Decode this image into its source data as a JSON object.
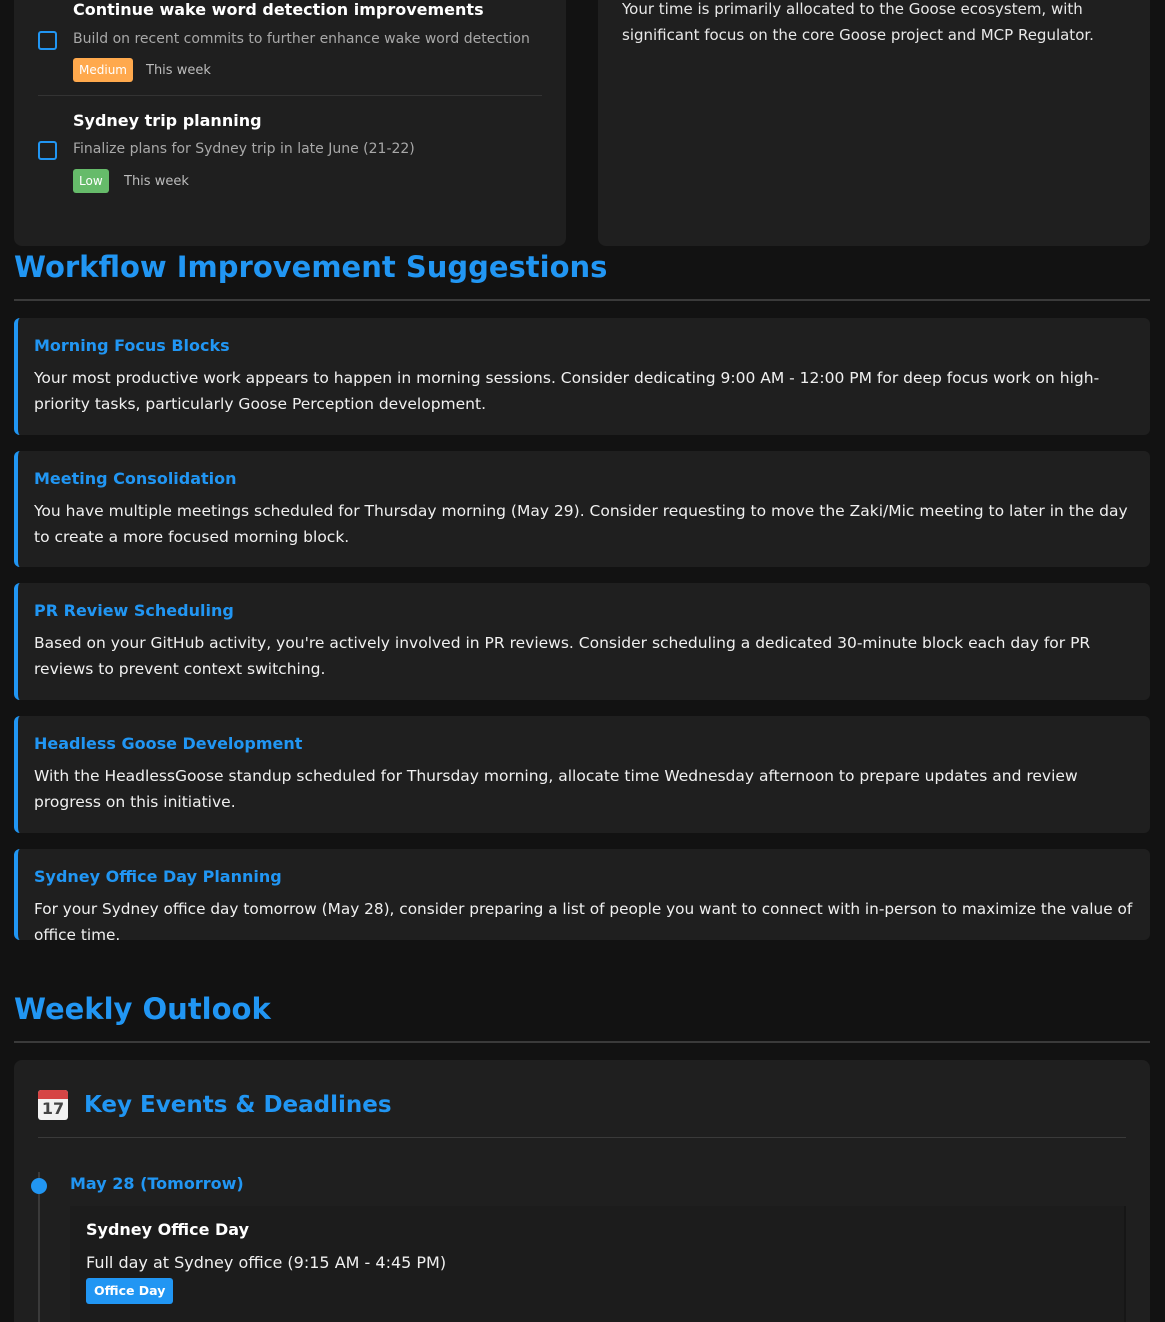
{
  "tasks": [
    {
      "title": "Continue wake word detection improvements",
      "description": "Build on recent commits to further enhance wake word detection",
      "priority": "Medium",
      "when": "This week"
    },
    {
      "title": "Sydney trip planning",
      "description": "Finalize plans for Sydney trip in late June (21-22)",
      "priority": "Low",
      "when": "This week"
    }
  ],
  "allocation": {
    "text": "Your time is primarily allocated to the Goose ecosystem, with significant focus on the core Goose project and MCP Regulator."
  },
  "workflow": {
    "title": "Workflow Improvement Suggestions",
    "suggestions": [
      {
        "title": "Morning Focus Blocks",
        "body": "Your most productive work appears to happen in morning sessions. Consider dedicating 9:00 AM - 12:00 PM for deep focus work on high-priority tasks, particularly Goose Perception development."
      },
      {
        "title": "Meeting Consolidation",
        "body": "You have multiple meetings scheduled for Thursday morning (May 29). Consider requesting to move the Zaki/Mic meeting to later in the day to create a more focused morning block."
      },
      {
        "title": "PR Review Scheduling",
        "body": "Based on your GitHub activity, you're actively involved in PR reviews. Consider scheduling a dedicated 30-minute block each day for PR reviews to prevent context switching."
      },
      {
        "title": "Headless Goose Development",
        "body": "With the HeadlessGoose standup scheduled for Thursday morning, allocate time Wednesday afternoon to prepare updates and review progress on this initiative."
      },
      {
        "title": "Sydney Office Day Planning",
        "body": "For your Sydney office day tomorrow (May 28), consider preparing a list of people you want to connect with in-person to maximize the value of office time."
      }
    ]
  },
  "outlook": {
    "title": "Weekly Outlook",
    "events_card": {
      "icon": "calendar-icon",
      "icon_day": "17",
      "title": "Key Events & Deadlines",
      "date": "May 28 (Tomorrow)",
      "event": {
        "name": "Sydney Office Day",
        "description": "Full day at Sydney office (9:15 AM - 4:45 PM)",
        "tag": "Office Day"
      }
    }
  },
  "colors": {
    "accent": "#2196f3",
    "medium": "#ffa94d",
    "low": "#66bb6a",
    "background": "#121212",
    "card": "#1f1f1f"
  }
}
